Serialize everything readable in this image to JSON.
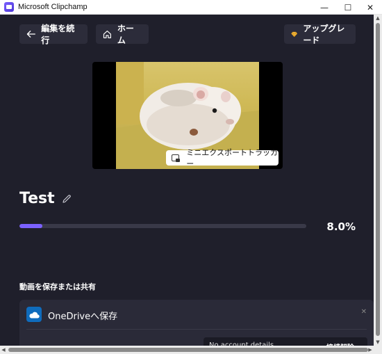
{
  "window": {
    "title": "Microsoft Clipchamp",
    "minimize": "—",
    "maximize": "☐",
    "close": "✕"
  },
  "topbar": {
    "back_label": "編集を続行",
    "home_label": "ホーム",
    "upgrade_label": "アップグレード"
  },
  "preview": {
    "tracker_label": "ミニエクスポートトラッカー"
  },
  "project": {
    "name": "Test",
    "progress_percent": 8.0,
    "progress_text": "8.0%"
  },
  "share": {
    "section_label": "動画を保存または共有",
    "onedrive_label": "OneDriveへ保存",
    "account_text": "No account details",
    "unlink_label": "接続解除"
  },
  "colors": {
    "accent": "#7b61ff",
    "background": "#1f1f2b",
    "button_bg": "#2c2c3a",
    "onedrive_blue": "#0f6cbd",
    "premium_gold": "#f5b940"
  },
  "icons": {
    "back": "arrow-left-icon",
    "home": "home-icon",
    "upgrade": "diamond-icon",
    "edit": "pencil-icon",
    "onedrive": "cloud-icon",
    "tracker": "picture-in-picture-icon"
  }
}
